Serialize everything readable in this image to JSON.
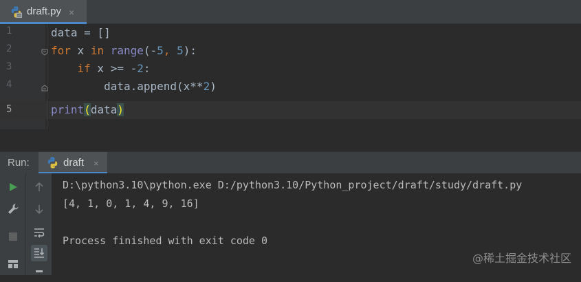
{
  "editor_tab": {
    "filename": "draft.py",
    "close_symbol": "×"
  },
  "editor": {
    "line_numbers": [
      "1",
      "2",
      "3",
      "4",
      "5"
    ],
    "lines": [
      [
        {
          "t": "data = []",
          "c": "plain"
        }
      ],
      [
        {
          "t": "for",
          "c": "kw"
        },
        {
          "t": " x ",
          "c": "plain"
        },
        {
          "t": "in",
          "c": "kw"
        },
        {
          "t": " ",
          "c": "plain"
        },
        {
          "t": "range",
          "c": "builtin"
        },
        {
          "t": "(-",
          "c": "plain"
        },
        {
          "t": "5",
          "c": "num"
        },
        {
          "t": ", ",
          "c": "kw"
        },
        {
          "t": "5",
          "c": "num"
        },
        {
          "t": "):",
          "c": "plain"
        }
      ],
      [
        {
          "t": "    ",
          "c": "plain"
        },
        {
          "t": "if",
          "c": "kw"
        },
        {
          "t": " x >= -",
          "c": "plain"
        },
        {
          "t": "2",
          "c": "num"
        },
        {
          "t": ":",
          "c": "plain"
        }
      ],
      [
        {
          "t": "        data.append(x**",
          "c": "plain"
        },
        {
          "t": "2",
          "c": "num"
        },
        {
          "t": ")",
          "c": "plain"
        }
      ],
      [
        {
          "t": "print",
          "c": "builtin"
        },
        {
          "t": "(",
          "c": "paren-hl"
        },
        {
          "t": "data",
          "c": "plain"
        },
        {
          "t": ")",
          "c": "paren-hl"
        }
      ]
    ]
  },
  "run_panel": {
    "label": "Run:",
    "tab_name": "draft",
    "close_symbol": "×"
  },
  "console": {
    "lines": [
      "D:\\python3.10\\python.exe D:/python3.10/Python_project/draft/study/draft.py",
      "[4, 1, 0, 1, 4, 9, 16]",
      "",
      "Process finished with exit code 0"
    ]
  },
  "watermark": "@稀土掘金技术社区",
  "colors": {
    "accent": "#4a88c7",
    "keyword": "#cc7832",
    "number": "#6897bb",
    "builtin": "#8888c6",
    "run_green": "#499c54"
  },
  "icons": {
    "toolbar_left": [
      "run-icon",
      "wrench-icon",
      "stop-icon",
      "layout-icon"
    ],
    "toolbar_right": [
      "arrow-up-icon",
      "arrow-down-icon",
      "soft-wrap-icon",
      "scroll-to-end-icon",
      "print-icon"
    ]
  }
}
